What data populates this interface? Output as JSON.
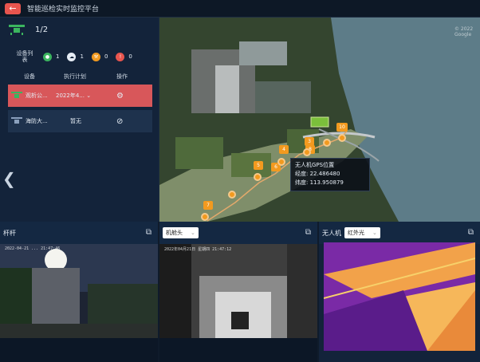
{
  "app": {
    "title": "智能巡检实时监控平台"
  },
  "panel": {
    "uav_count": "1/2",
    "device_list_label": "设备列表",
    "stats": [
      {
        "value": "1",
        "color": "#3bb55f",
        "icon": "online-icon"
      },
      {
        "value": "1",
        "color": "#e6edf5",
        "icon": "cloud-icon"
      },
      {
        "value": "0",
        "color": "#f29a1f",
        "icon": "tools-icon"
      },
      {
        "value": "0",
        "color": "#e8554e",
        "icon": "warning-icon"
      }
    ],
    "columns": [
      "设备",
      "执行计划",
      "操作"
    ],
    "rows": [
      {
        "name": "观析公...",
        "plan": "2022年4...",
        "op_icon": "settings-icon"
      },
      {
        "name": "海防大...",
        "plan": "暂无",
        "op_icon": "disabled-icon"
      }
    ]
  },
  "map": {
    "tooltip": {
      "title": "无人机GPS位置",
      "lng": "经度: 22.486480",
      "lat": "纬度: 113.950879"
    },
    "markers": [
      "3",
      "4",
      "5",
      "6",
      "7",
      "8",
      "10"
    ],
    "watermark": "© 2022 Google"
  },
  "feeds": [
    {
      "title": "杆杆"
    },
    {
      "select_value": "机舱头"
    },
    {
      "title": "无人机",
      "select_value": "红外光"
    }
  ],
  "timestamps": [
    "2022-04-21 ... 21:47:46",
    "2022年04月21日 星期四 21:47:12",
    "21:47:12"
  ],
  "colors": {
    "accent": "#e8554e",
    "panel": "#13233a",
    "marker": "#f29a1f"
  }
}
